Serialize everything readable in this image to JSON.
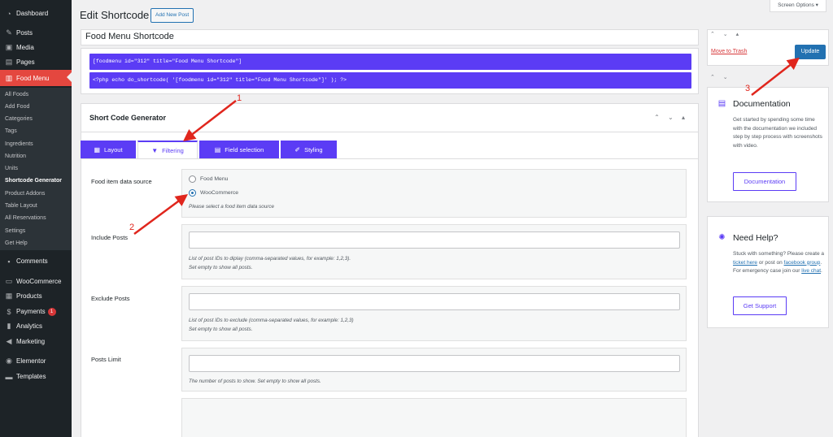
{
  "sidebar": {
    "items": [
      {
        "label": "Dashboard",
        "icon": "dashboard-icon"
      },
      {
        "label": "Posts",
        "icon": "pin-icon"
      },
      {
        "label": "Media",
        "icon": "media-icon"
      },
      {
        "label": "Pages",
        "icon": "pages-icon"
      },
      {
        "label": "Food Menu",
        "icon": "food-menu-icon"
      },
      {
        "label": "Comments",
        "icon": "comments-icon"
      },
      {
        "label": "WooCommerce",
        "icon": "woocommerce-icon"
      },
      {
        "label": "Products",
        "icon": "products-icon"
      },
      {
        "label": "Payments",
        "icon": "payments-icon",
        "badge": "1"
      },
      {
        "label": "Analytics",
        "icon": "analytics-icon"
      },
      {
        "label": "Marketing",
        "icon": "marketing-icon"
      },
      {
        "label": "Elementor",
        "icon": "elementor-icon"
      },
      {
        "label": "Templates",
        "icon": "templates-icon"
      }
    ],
    "submenu": [
      "All Foods",
      "Add Food",
      "Categories",
      "Tags",
      "Ingredients",
      "Nutrition",
      "Units",
      "Shortcode Generator",
      "Product Addons",
      "Table Layout",
      "All Reservations",
      "Settings",
      "Get Help"
    ]
  },
  "header": {
    "title": "Edit Shortcode",
    "add_new": "Add New Post",
    "screen_options": "Screen Options ▾"
  },
  "post_title": "Food Menu Shortcode",
  "shortcodes": {
    "line1": "[foodmenu id=\"312\" title=\"Food Menu Shortcode\"]",
    "line2": "<?php echo do_shortcode( '[foodmenu id=\"312\" title=\"Food Menu Shortcode\"]' ); ?>"
  },
  "generator": {
    "title": "Short Code Generator",
    "controls": "⌃ ⌄ ▴",
    "tabs": [
      {
        "label": "Layout",
        "icon": "layout-icon"
      },
      {
        "label": "Filtering",
        "icon": "filter-icon"
      },
      {
        "label": "Field selection",
        "icon": "field-selection-icon"
      },
      {
        "label": "Styling",
        "icon": "brush-icon"
      }
    ],
    "active_tab": "Filtering"
  },
  "fields": {
    "source": {
      "label": "Food item data source",
      "options": [
        "Food Menu",
        "WooCommerce"
      ],
      "selected": "WooCommerce",
      "help": "Please select a food item data source"
    },
    "include": {
      "label": "Include Posts",
      "value": "",
      "help1": "List of post IDs to diplay (comma-separated values, for example: 1,2,3).",
      "help2": "Set empty to show all posts."
    },
    "exclude": {
      "label": "Exclude Posts",
      "value": "",
      "help1": "List of post IDs to exclude (comma-separated values, for example: 1,2,3)",
      "help2": "Set empty to show all posts."
    },
    "limit": {
      "label": "Posts Limit",
      "value": "",
      "help": "The number of posts to show. Set empty to show all posts."
    }
  },
  "publish": {
    "controls": "⌃ ⌄ ▴",
    "trash": "Move to Trash",
    "update": "Update",
    "controls2": "⌃ ⌄"
  },
  "documentation": {
    "title": "Documentation",
    "text": "Get started by spending some time with the documentation we included step by step process with screenshots with video.",
    "button": "Documentation"
  },
  "help": {
    "title": "Need Help?",
    "text_before": "Stuck with something? Please create a",
    "link1": "ticket here",
    "text_mid": "or post on",
    "link2": "facebook group",
    "text_mid2": ". For emergency case join our",
    "link3": "live chat",
    "text_end": ".",
    "button": "Get Support"
  },
  "annotations": [
    "1",
    "2",
    "3"
  ],
  "colors": {
    "accent": "#5b3cf5",
    "wp_blue": "#2271b1",
    "sidebar": "#1d2327",
    "current_menu": "#e4473f",
    "annotation": "#e0261d"
  }
}
